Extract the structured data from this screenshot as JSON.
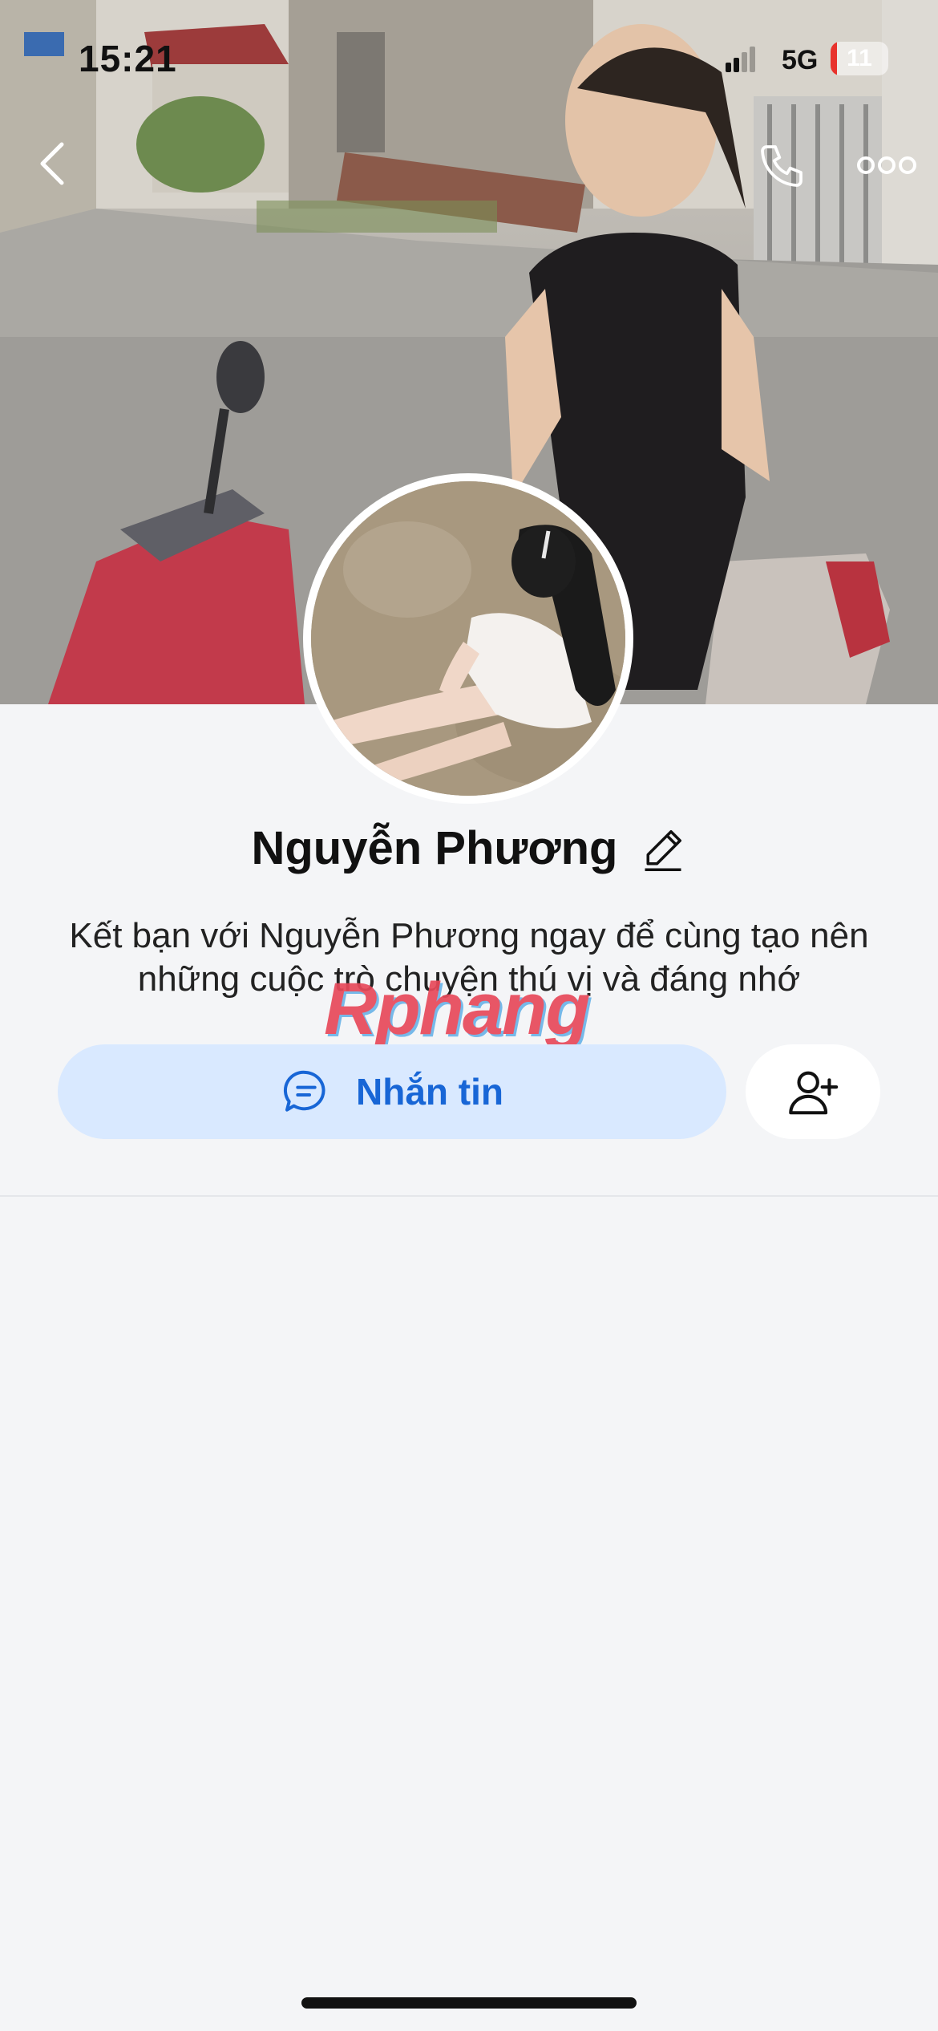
{
  "status_bar": {
    "time": "15:21",
    "network": "5G",
    "battery_level": "11",
    "battery_color": "#e8322c"
  },
  "nav": {
    "back_icon": "chevron-left-icon",
    "call_icon": "phone-icon",
    "more_icon": "more-horizontal-icon"
  },
  "profile": {
    "name": "Nguyễn Phương",
    "description": "Kết bạn với Nguyễn Phương ngay để cùng tạo nên những cuộc trò chuyện thú vị và đáng nhớ"
  },
  "watermark": "Rphang",
  "actions": {
    "message_label": "Nhắn tin",
    "message_icon": "chat-bubble-icon",
    "add_friend_icon": "add-user-icon"
  },
  "colors": {
    "accent": "#1866d6",
    "message_button_bg": "#d9e9ff",
    "page_bg": "#f4f5f7"
  }
}
